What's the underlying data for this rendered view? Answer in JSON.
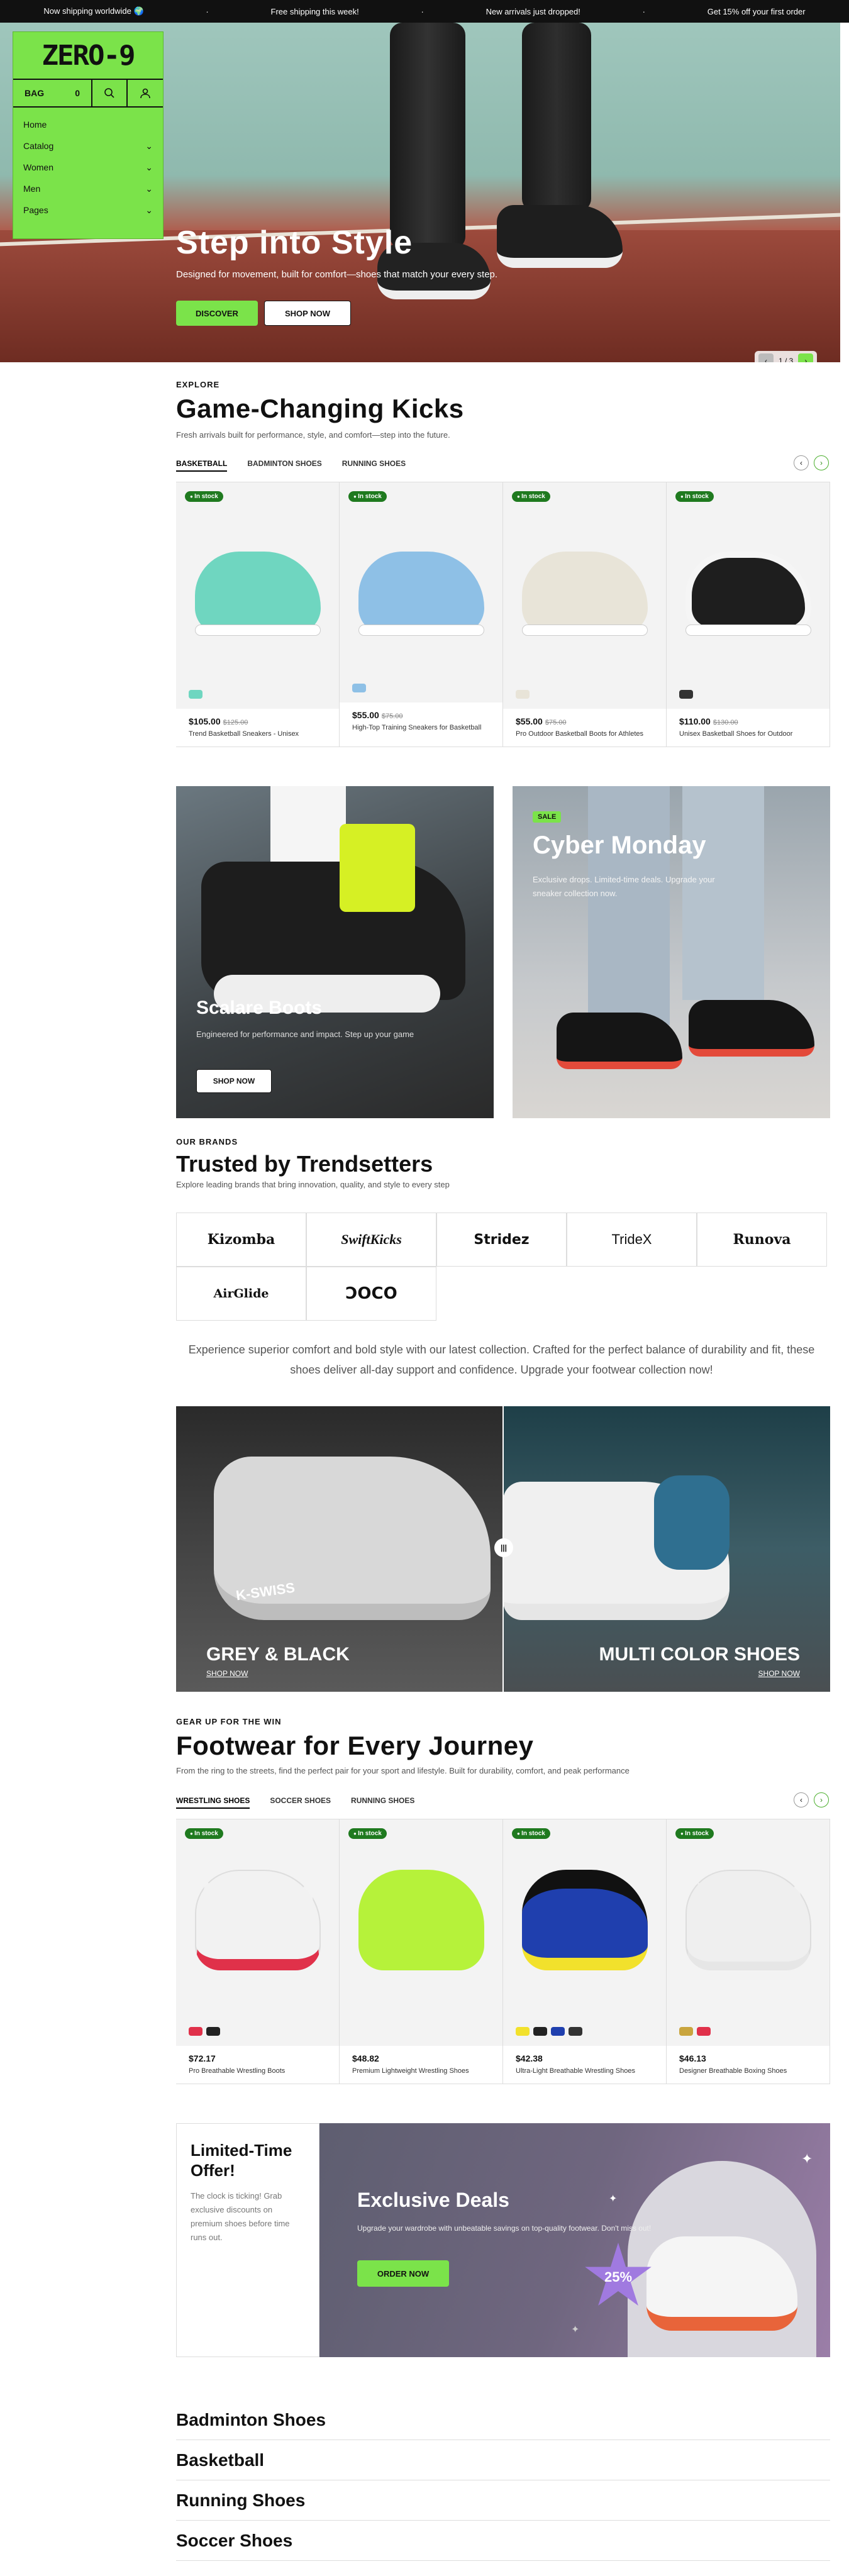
{
  "announcement": [
    "Now shipping worldwide 🌍",
    "Free shipping this week!",
    "New arrivals just dropped!",
    "Get 15% off your first order"
  ],
  "nav": {
    "logo": "ZERO-9",
    "bag_label": "BAG",
    "bag_count": "0",
    "menu": [
      "Home",
      "Catalog",
      "Women",
      "Men",
      "Pages"
    ]
  },
  "hero": {
    "title": "Step into Style",
    "subtitle": "Designed for movement, built for comfort—shoes that match your every step.",
    "btn_primary": "DISCOVER",
    "btn_secondary": "SHOP NOW",
    "pager": "1 / 3"
  },
  "explore": {
    "eyebrow": "EXPLORE",
    "title": "Game-Changing Kicks",
    "subtitle": "Fresh arrivals built for performance, style, and comfort—step into the future.",
    "tabs": [
      "BASKETBALL",
      "BADMINTON SHOES",
      "RUNNING SHOES"
    ],
    "products": [
      {
        "badge": "In stock",
        "price": "$105.00",
        "old": "$125.00",
        "name": "Trend Basketball Sneakers - Unisex",
        "color": "#6fd6c0"
      },
      {
        "badge": "In stock",
        "price": "$55.00",
        "old": "$75.00",
        "name": "High-Top Training Sneakers for Basketball",
        "color": "#8ec0e6"
      },
      {
        "badge": "In stock",
        "price": "$55.00",
        "old": "$75.00",
        "name": "Pro Outdoor Basketball Boots for Athletes",
        "color": "#e8e4d8"
      },
      {
        "badge": "In stock",
        "price": "$110.00",
        "old": "$130.00",
        "name": "Unisex Basketball Shoes for Outdoor",
        "color": "#1e1e1e"
      }
    ]
  },
  "promo1": {
    "title": "Scalare Boots",
    "text": "Engineered for performance and impact. Step up your game",
    "btn": "SHOP NOW"
  },
  "promo2": {
    "badge": "SALE",
    "title": "Cyber Monday",
    "text": "Exclusive drops. Limited-time deals. Upgrade your sneaker collection now."
  },
  "brands": {
    "eyebrow": "OUR BRANDS",
    "title": "Trusted by Trendsetters",
    "subtitle": "Explore leading brands that bring innovation, quality, and style to every step",
    "items": [
      "Kizomba",
      "SwiftKicks",
      "Stridez",
      "TrideX",
      "Runova",
      "AirGlide",
      "ƆOCO"
    ]
  },
  "center_text": "Experience superior comfort and bold style with our latest collection. Crafted for the perfect balance of durability and fit, these shoes deliver all-day support and confidence. Upgrade your footwear collection now!",
  "compare": {
    "left_title": "GREY & BLACK",
    "left_link": "SHOP NOW",
    "right_title": "MULTI COLOR SHOES",
    "right_link": "SHOP NOW",
    "left_brand": "K-SWISS"
  },
  "journey": {
    "eyebrow": "GEAR UP FOR THE WIN",
    "title": "Footwear for Every Journey",
    "subtitle": "From the ring to the streets, find the perfect pair for your sport and lifestyle. Built for durability, comfort, and peak performance",
    "tabs": [
      "WRESTLING SHOES",
      "SOCCER SHOES",
      "RUNNING SHOES"
    ],
    "products": [
      {
        "badge": "In stock",
        "price": "$72.17",
        "name": "Pro Breathable Wrestling Boots",
        "color": "#f2f2f2"
      },
      {
        "badge": "In stock",
        "price": "$48.82",
        "name": "Premium Lightweight Wrestling Shoes",
        "color": "#b6f23a"
      },
      {
        "badge": "In stock",
        "price": "$42.38",
        "name": "Ultra-Light Breathable Wrestling Shoes",
        "color": "#1f3fae"
      },
      {
        "badge": "In stock",
        "price": "$46.13",
        "name": "Designer Breathable Boxing Shoes",
        "color": "#efefef"
      }
    ]
  },
  "offer": {
    "title": "Limited-Time Offer!",
    "text": "The clock is ticking! Grab exclusive discounts on premium shoes before time runs out.",
    "deal_title": "Exclusive Deals",
    "deal_text": "Upgrade your wardrobe with unbeatable savings on top-quality footwear. Don't miss out!",
    "btn": "ORDER NOW",
    "discount": "25%"
  },
  "footer_cats": [
    "Badminton Shoes",
    "Basketball",
    "Running Shoes",
    "Soccer Shoes"
  ],
  "colors": {
    "accent": "#7be34a",
    "stock": "#1f7a1f"
  }
}
